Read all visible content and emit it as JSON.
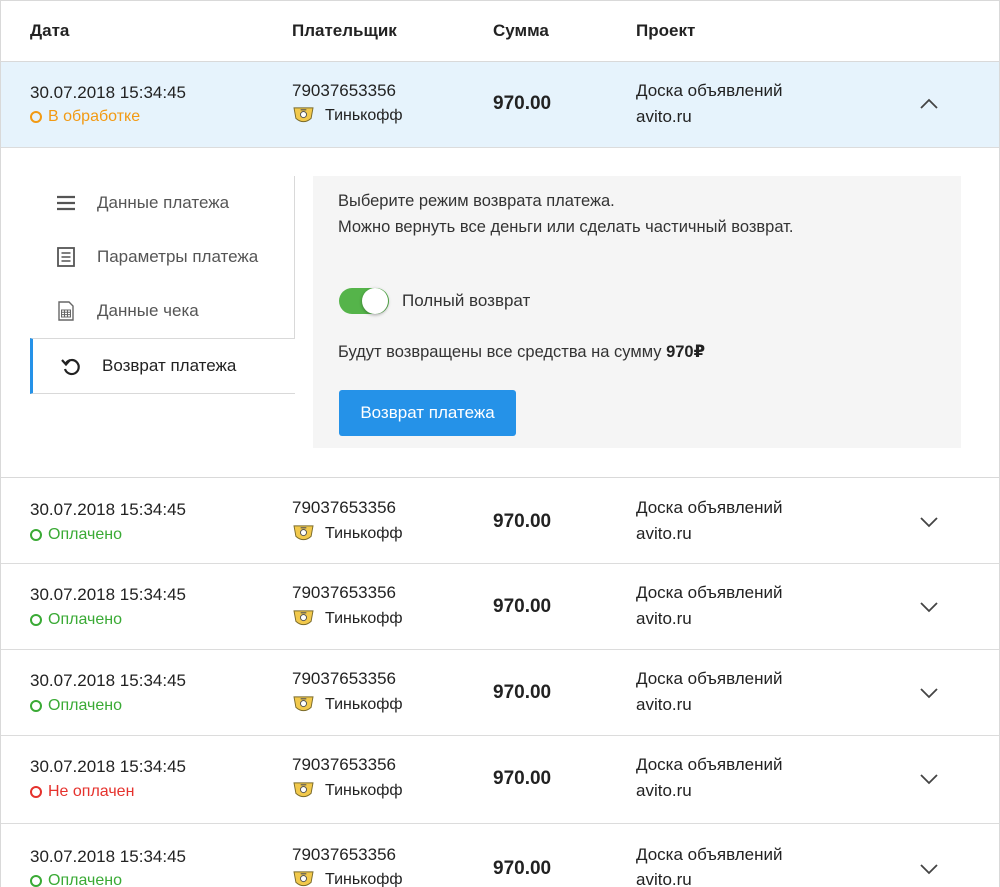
{
  "header": {
    "date": "Дата",
    "payer": "Плательщик",
    "sum": "Сумма",
    "project": "Проект"
  },
  "colors": {
    "accent": "#2592e8",
    "active_row_bg": "#e6f3fc",
    "processing": "#f29a13",
    "paid": "#3aaa35",
    "unpaid": "#e5322d",
    "toggle_on": "#55b44a"
  },
  "rows": [
    {
      "date": "30.07.2018 15:34:45",
      "status": "В обработке",
      "status_kind": "processing",
      "payer_phone": "79037653356",
      "bank": "Тинькофф",
      "sum": "970.00",
      "project_name": "Доска объявлений",
      "project_domain": "avito.ru",
      "expanded": true
    },
    {
      "date": "30.07.2018 15:34:45",
      "status": "Оплачено",
      "status_kind": "paid",
      "payer_phone": "79037653356",
      "bank": "Тинькофф",
      "sum": "970.00",
      "project_name": "Доска объявлений",
      "project_domain": "avito.ru",
      "expanded": false
    },
    {
      "date": "30.07.2018 15:34:45",
      "status": "Оплачено",
      "status_kind": "paid",
      "payer_phone": "79037653356",
      "bank": "Тинькофф",
      "sum": "970.00",
      "project_name": "Доска объявлений",
      "project_domain": "avito.ru",
      "expanded": false
    },
    {
      "date": "30.07.2018 15:34:45",
      "status": "Оплачено",
      "status_kind": "paid",
      "payer_phone": "79037653356",
      "bank": "Тинькофф",
      "sum": "970.00",
      "project_name": "Доска объявлений",
      "project_domain": "avito.ru",
      "expanded": false
    },
    {
      "date": "30.07.2018 15:34:45",
      "status": "Не оплачен",
      "status_kind": "unpaid",
      "payer_phone": "79037653356",
      "bank": "Тинькофф",
      "sum": "970.00",
      "project_name": "Доска объявлений",
      "project_domain": "avito.ru",
      "expanded": false
    },
    {
      "date": "30.07.2018 15:34:45",
      "status": "Оплачено",
      "status_kind": "paid",
      "payer_phone": "79037653356",
      "bank": "Тинькофф",
      "sum": "970.00",
      "project_name": "Доска объявлений",
      "project_domain": "avito.ru",
      "expanded": false
    }
  ],
  "details": {
    "nav": [
      {
        "label": "Данные платежа",
        "icon": "menu-lines-icon",
        "active": false
      },
      {
        "label": "Параметры платежа",
        "icon": "document-icon",
        "active": false
      },
      {
        "label": "Данные чека",
        "icon": "receipt-grid-icon",
        "active": false
      },
      {
        "label": "Возврат платежа",
        "icon": "refund-arrow-icon",
        "active": true
      }
    ],
    "refund": {
      "line1": "Выберите режим возврата платежа.",
      "line2": "Можно вернуть все деньги или сделать частичный возврат.",
      "toggle_label": "Полный возврат",
      "toggle_on": true,
      "sum_text": "Будут возвращены все средства на сумму",
      "sum_value": "970₽",
      "button_label": "Возврат платежа"
    }
  }
}
